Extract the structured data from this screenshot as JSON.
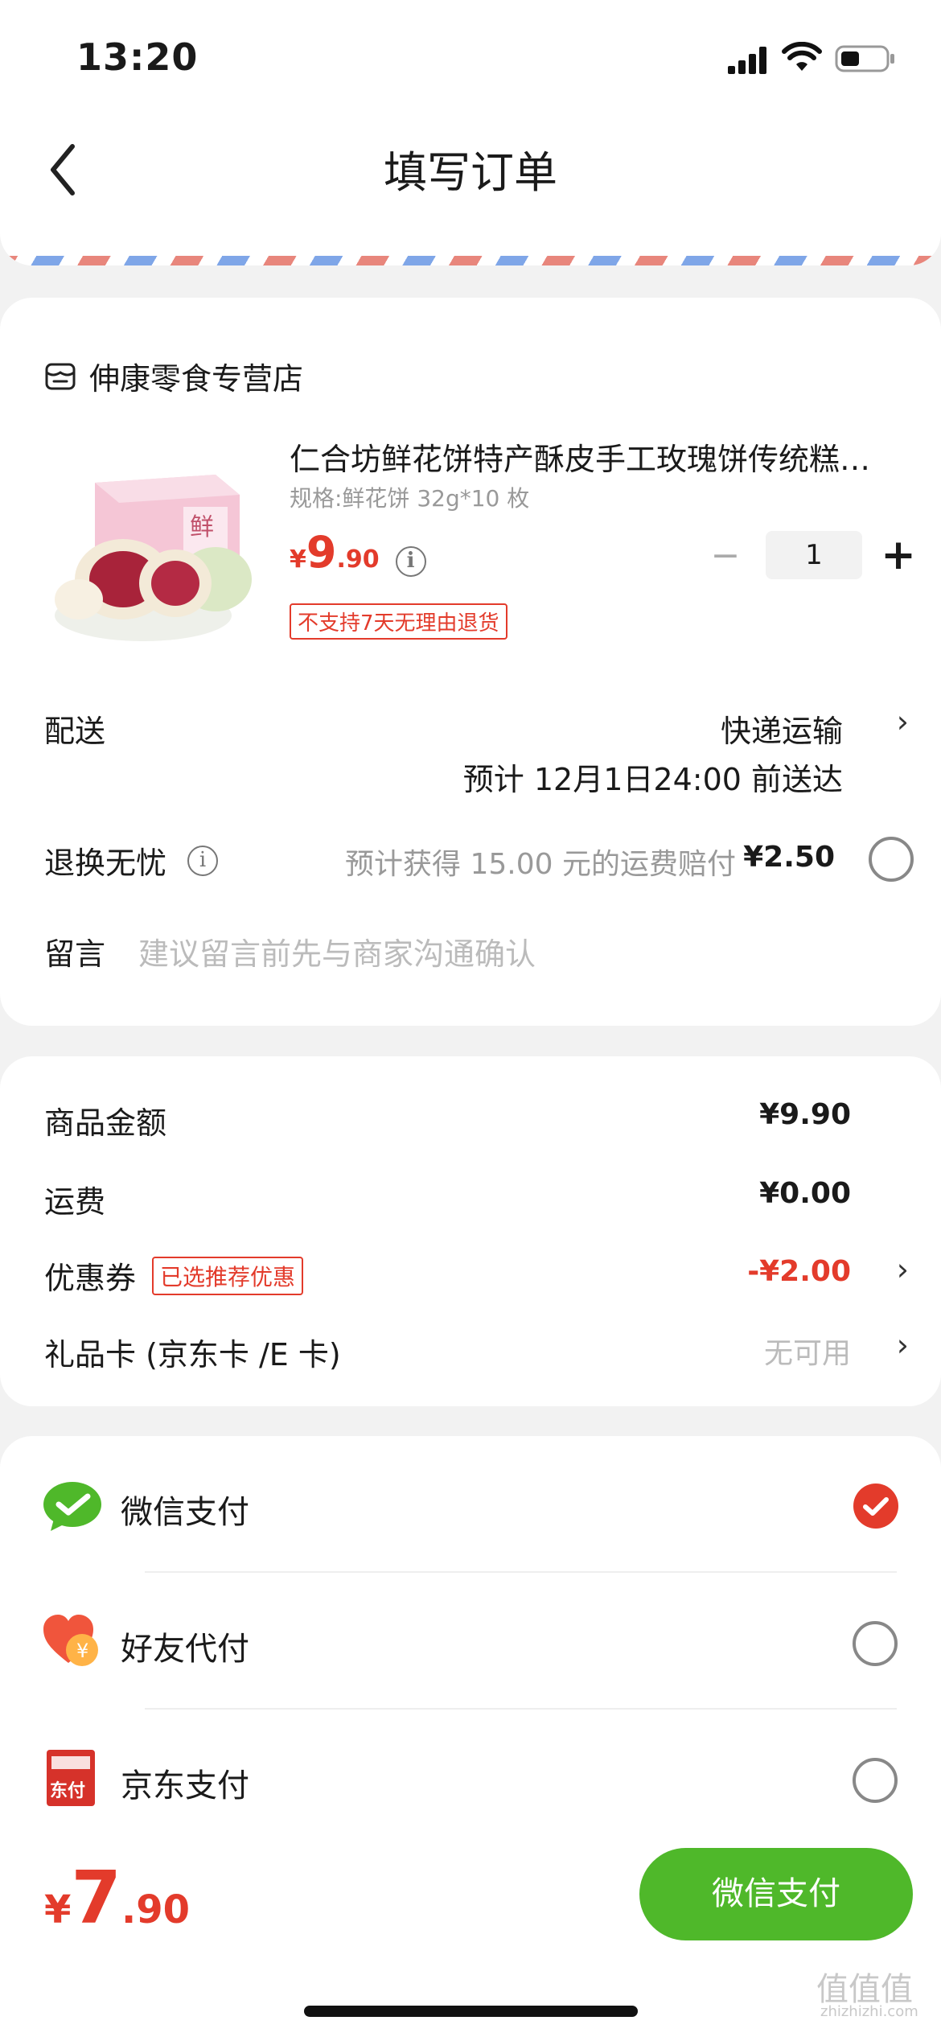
{
  "status_bar": {
    "time": "13:20"
  },
  "nav": {
    "title": "填写订单"
  },
  "order": {
    "shop_name": "伸康零食专营店",
    "product": {
      "title": "仁合坊鲜花饼特产酥皮手工玫瑰饼传统糕…",
      "spec": "规格:鲜花饼 32g*10 枚",
      "price_currency": "¥",
      "price_int": "9",
      "price_dec": ".90",
      "quantity": "1",
      "return_badge": "不支持7天无理由退货",
      "image_box_text": "鲜"
    },
    "delivery": {
      "label": "配送",
      "method": "快递运输",
      "eta": "预计 12月1日24:00 前送达"
    },
    "return_worry": {
      "label": "退换无忧",
      "note": "预计获得 15.00 元的运费赔付",
      "price": "¥2.50"
    },
    "message": {
      "label": "留言",
      "placeholder": "建议留言前先与商家沟通确认"
    }
  },
  "summary": {
    "goods_amount": {
      "label": "商品金额",
      "value": "¥9.90"
    },
    "shipping": {
      "label": "运费",
      "value": "¥0.00"
    },
    "coupon": {
      "label": "优惠券",
      "tag": "已选推荐优惠",
      "value": "-¥2.00"
    },
    "gift_card": {
      "label": "礼品卡 (京东卡 /E 卡)",
      "value": "无可用"
    }
  },
  "payment": {
    "methods": [
      {
        "label": "微信支付",
        "selected": true
      },
      {
        "label": "好友代付",
        "selected": false
      },
      {
        "label": "京东支付",
        "selected": false
      }
    ],
    "friend_icon_text": "¥",
    "jd_icon_text": "东付"
  },
  "footer": {
    "currency": "¥",
    "total_int": "7",
    "total_dec": ".90",
    "pay_button": "微信支付"
  },
  "watermark": {
    "text": "值值值",
    "domain": "zhizhizhi.com"
  },
  "colors": {
    "accent_red": "#e33b2b",
    "wechat_green": "#4fb82a"
  }
}
